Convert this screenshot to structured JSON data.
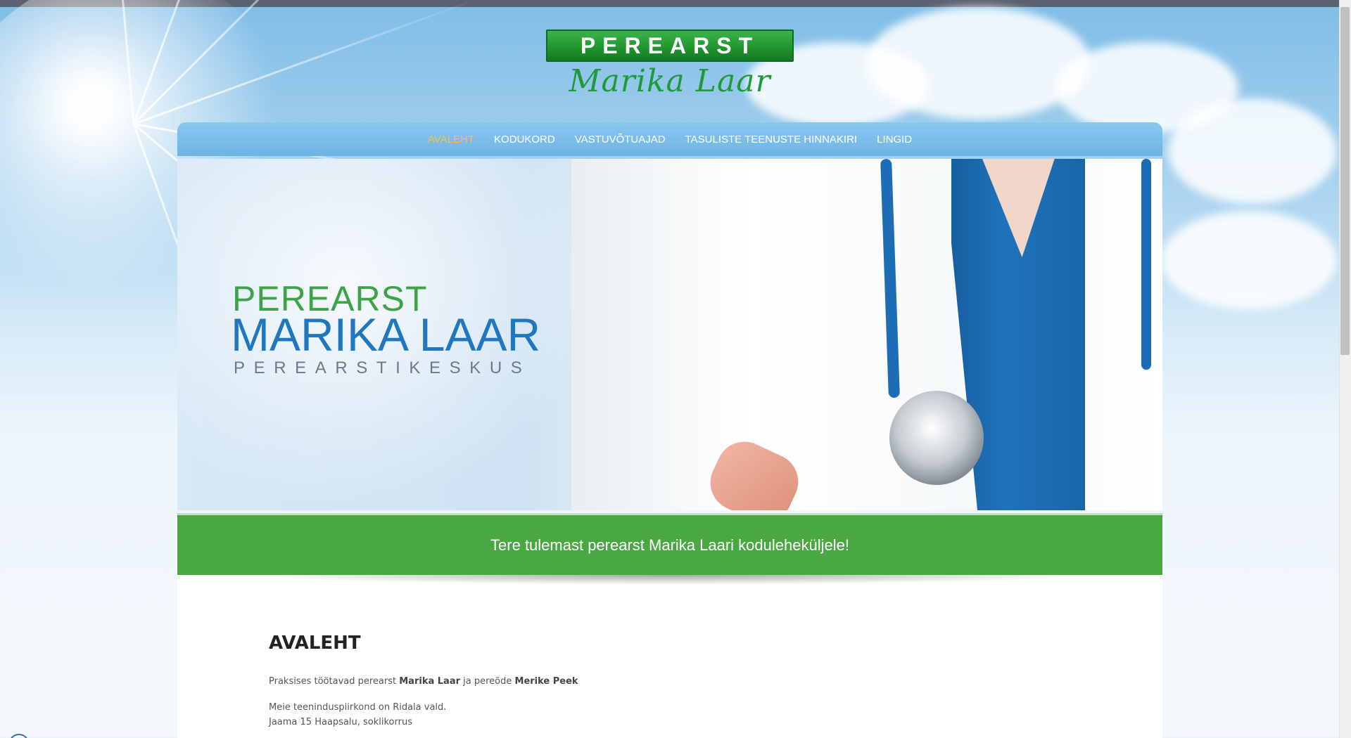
{
  "logo": {
    "top_text": "PEREARST",
    "script_text": "Marika Laar"
  },
  "nav": {
    "items": [
      {
        "label": "AVALEHT",
        "active": true
      },
      {
        "label": "KODUKORD",
        "active": false
      },
      {
        "label": "VASTUVÕTUAJAD",
        "active": false
      },
      {
        "label": "TASULISTE TEENUSTE HINNAKIRI",
        "active": false
      },
      {
        "label": "LINGID",
        "active": false
      }
    ]
  },
  "hero": {
    "line1": "PEREARST",
    "line2": "MARIKA LAAR",
    "line3": "PEREARSTIKESKUS"
  },
  "banner": {
    "text": "Tere tulemast perearst Marika Laari koduleheküljele!"
  },
  "content": {
    "heading": "AVALEHT",
    "staff": {
      "prefix": "Praksises töötavad perearst ",
      "doctor": "Marika Laar",
      "middle": " ja pereõde ",
      "nurse": "Merike Peek"
    },
    "area": "Meie teeninduspiirkond on Ridala vald.",
    "address": "Jaama 15 Haapsalu, soklikorrus"
  },
  "colors": {
    "nav_active": "#f7c04a",
    "banner_green": "#4aa843",
    "hero_green": "#3ea246",
    "hero_blue": "#1f77bf"
  }
}
